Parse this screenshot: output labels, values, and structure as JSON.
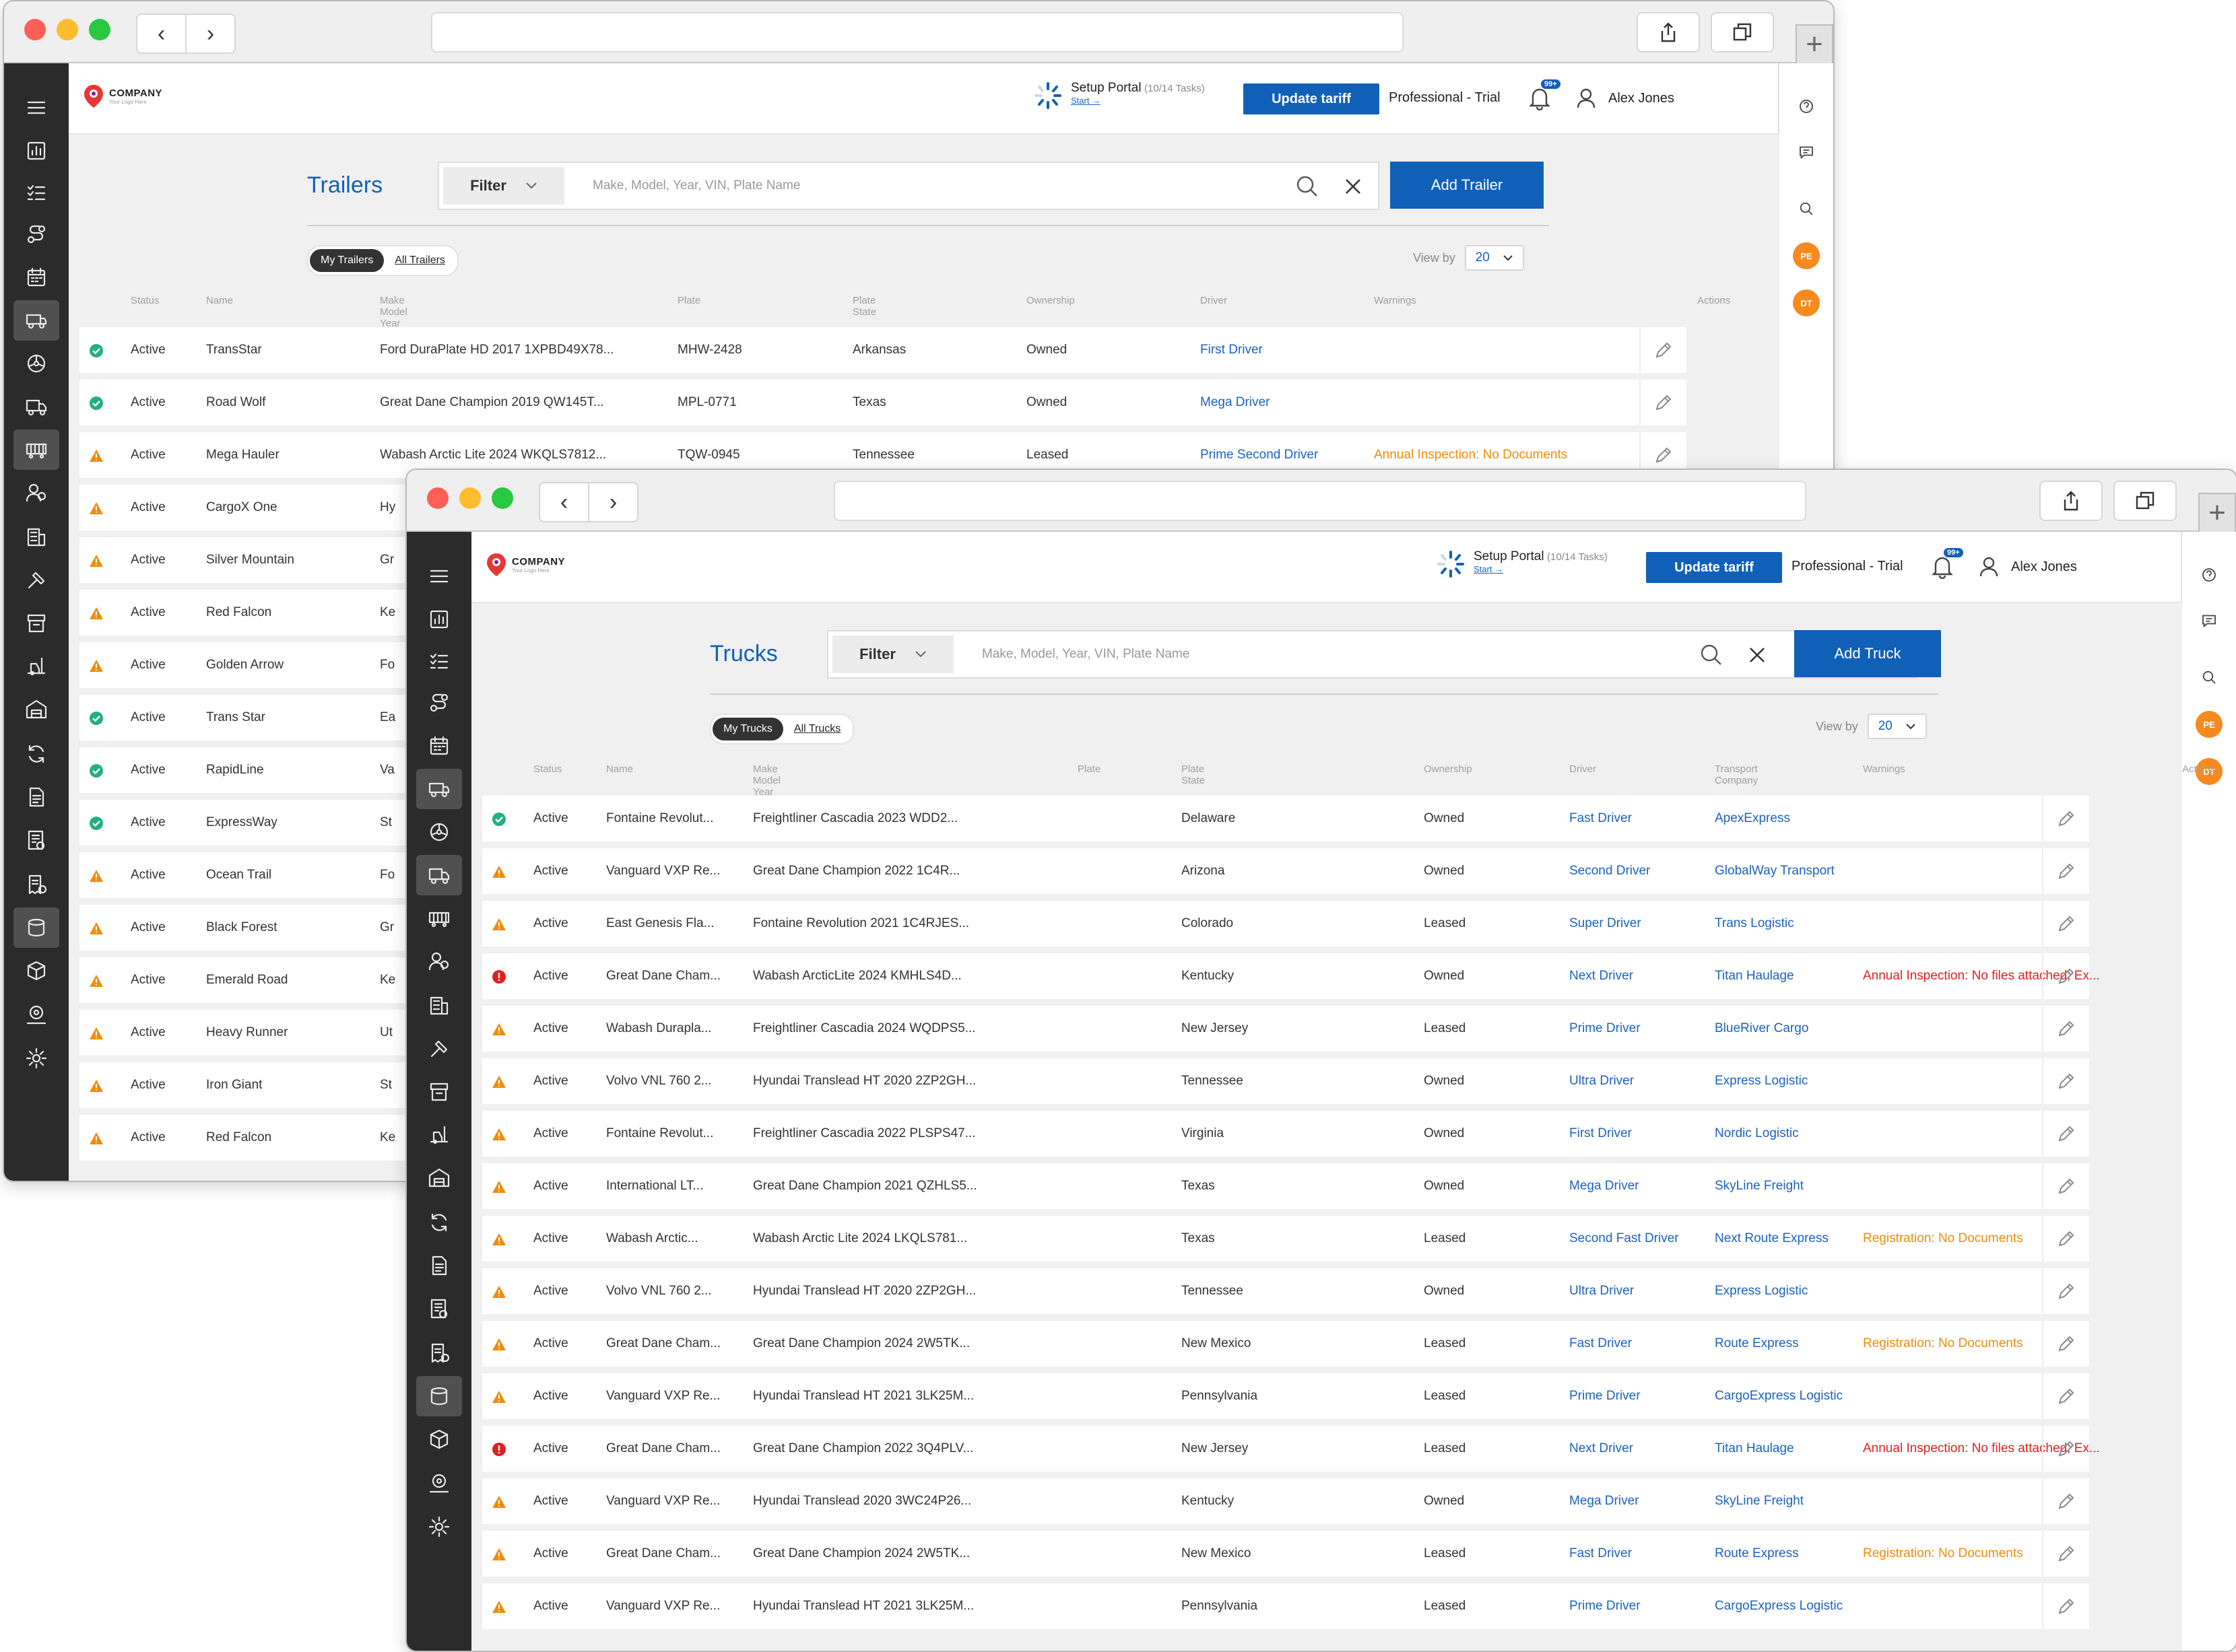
{
  "colors": {
    "accent": "#1160b8",
    "link": "#1a62c0",
    "ok": "#22b07d",
    "warn": "#f08c0a",
    "error": "#e02020",
    "sidebar": "#2b2b2b",
    "badge": "#f68a1e"
  },
  "common": {
    "logo_name": "COMPANY",
    "logo_tagline": "Your Logo Here",
    "setup_title": "Setup Portal",
    "setup_tasks": "(10/14 Tasks)",
    "setup_start": "Start →",
    "update_btn": "Update tariff",
    "plan": "Professional - Trial",
    "notif_badge": "99+",
    "user_name": "Alex Jones",
    "filter_label": "Filter",
    "search_placeholder": "Make, Model, Year, VIN, Plate Name",
    "view_by_label": "View by",
    "view_by_value": "20",
    "rightbar_badges": [
      "PE",
      "DT"
    ],
    "sidebar_icons": [
      "menu-icon",
      "dashboard-icon",
      "checklist-icon",
      "routes-icon",
      "calendar-icon",
      "trailer-icon",
      "wheel-icon",
      "truck-icon",
      "container-icon",
      "drivers-icon",
      "buildings-icon",
      "tools-icon",
      "archive-icon",
      "forklift-icon",
      "warehouse-icon",
      "sync-icon",
      "documents-icon",
      "reports-icon",
      "invoice-icon",
      "storage-icon",
      "package-icon",
      "location-icon",
      "settings-icon"
    ]
  },
  "trailers": {
    "title": "Trailers",
    "add_btn": "Add Trailer",
    "tab_mine": "My Trailers",
    "tab_all": "All Trailers",
    "columns": [
      "Status",
      "Name",
      "Make Model Year VIN",
      "Plate",
      "Plate State",
      "Ownership",
      "Driver",
      "Warnings",
      "Actions"
    ],
    "rows": [
      {
        "s": "ok",
        "status": "Active",
        "name": "TransStar",
        "vin": "Ford DuraPlate HD 2017 1XPBD49X78...",
        "plate": "MHW-2428",
        "state": "Arkansas",
        "own": "Owned",
        "driver": "First Driver",
        "warn": "",
        "wl": ""
      },
      {
        "s": "ok",
        "status": "Active",
        "name": "Road Wolf",
        "vin": "Great Dane Champion 2019 QW145T...",
        "plate": "MPL-0771",
        "state": "Texas",
        "own": "Owned",
        "driver": "Mega Driver",
        "warn": "",
        "wl": ""
      },
      {
        "s": "warn",
        "status": "Active",
        "name": "Mega Hauler",
        "vin": "Wabash Arctic Lite 2024 WKQLS7812...",
        "plate": "TQW-0945",
        "state": "Tennessee",
        "own": "Leased",
        "driver": "Prime Second Driver",
        "warn": "Annual Inspection: No Documents",
        "wl": "warn"
      },
      {
        "s": "warn",
        "status": "Active",
        "name": "CargoX One",
        "vin": "Hy",
        "plate": "",
        "state": "",
        "own": "",
        "driver": "",
        "warn": "",
        "wl": ""
      },
      {
        "s": "warn",
        "status": "Active",
        "name": "Silver Mountain",
        "vin": "Gr",
        "plate": "",
        "state": "",
        "own": "",
        "driver": "",
        "warn": "",
        "wl": ""
      },
      {
        "s": "warn",
        "status": "Active",
        "name": "Red Falcon",
        "vin": "Ke",
        "plate": "",
        "state": "",
        "own": "",
        "driver": "",
        "warn": "",
        "wl": ""
      },
      {
        "s": "warn",
        "status": "Active",
        "name": "Golden Arrow",
        "vin": "Fo",
        "plate": "",
        "state": "",
        "own": "",
        "driver": "",
        "warn": "",
        "wl": ""
      },
      {
        "s": "ok",
        "status": "Active",
        "name": "Trans Star",
        "vin": "Ea",
        "plate": "",
        "state": "",
        "own": "",
        "driver": "",
        "warn": "",
        "wl": ""
      },
      {
        "s": "ok",
        "status": "Active",
        "name": "RapidLine",
        "vin": "Va",
        "plate": "",
        "state": "",
        "own": "",
        "driver": "",
        "warn": "",
        "wl": ""
      },
      {
        "s": "ok",
        "status": "Active",
        "name": "ExpressWay",
        "vin": "St",
        "plate": "",
        "state": "",
        "own": "",
        "driver": "",
        "warn": "",
        "wl": ""
      },
      {
        "s": "warn",
        "status": "Active",
        "name": "Ocean Trail",
        "vin": "Fo",
        "plate": "",
        "state": "",
        "own": "",
        "driver": "",
        "warn": "",
        "wl": ""
      },
      {
        "s": "warn",
        "status": "Active",
        "name": "Black Forest",
        "vin": "Gr",
        "plate": "",
        "state": "",
        "own": "",
        "driver": "",
        "warn": "",
        "wl": ""
      },
      {
        "s": "warn",
        "status": "Active",
        "name": "Emerald Road",
        "vin": "Ke",
        "plate": "",
        "state": "",
        "own": "",
        "driver": "",
        "warn": "",
        "wl": ""
      },
      {
        "s": "warn",
        "status": "Active",
        "name": "Heavy Runner",
        "vin": "Ut",
        "plate": "",
        "state": "",
        "own": "",
        "driver": "",
        "warn": "",
        "wl": ""
      },
      {
        "s": "warn",
        "status": "Active",
        "name": "Iron Giant",
        "vin": "St",
        "plate": "",
        "state": "",
        "own": "",
        "driver": "",
        "warn": "",
        "wl": ""
      },
      {
        "s": "warn",
        "status": "Active",
        "name": "Red Falcon",
        "vin": "Ke",
        "plate": "",
        "state": "",
        "own": "",
        "driver": "",
        "warn": "",
        "wl": ""
      }
    ]
  },
  "trucks": {
    "title": "Trucks",
    "add_btn": "Add Truck",
    "tab_mine": "My Trucks",
    "tab_all": "All Trucks",
    "columns": [
      "Status",
      "Name",
      "Make Model Year VIN",
      "Plate",
      "Plate State",
      "Ownership",
      "Driver",
      "Transport Company",
      "Warnings",
      "Actions"
    ],
    "rows": [
      {
        "s": "ok",
        "status": "Active",
        "name": "Fontaine Revolut...",
        "vin": "Freightliner Cascadia 2023 WDD2...",
        "state": "Delaware",
        "own": "Owned",
        "driver": "Fast Driver",
        "company": "ApexExpress",
        "warn": "",
        "wl": ""
      },
      {
        "s": "warn",
        "status": "Active",
        "name": "Vanguard VXP Re...",
        "vin": "Great Dane Champion 2022 1C4R...",
        "state": "Arizona",
        "own": "Owned",
        "driver": "Second Driver",
        "company": "GlobalWay Transport",
        "warn": "",
        "wl": ""
      },
      {
        "s": "warn",
        "status": "Active",
        "name": "East Genesis Fla...",
        "vin": "Fontaine Revolution 2021 1C4RJES...",
        "state": "Colorado",
        "own": "Leased",
        "driver": "Super Driver",
        "company": "Trans Logistic",
        "warn": "",
        "wl": ""
      },
      {
        "s": "err",
        "status": "Active",
        "name": "Great Dane Cham...",
        "vin": "Wabash ArcticLite 2024 KMHLS4D...",
        "state": "Kentucky",
        "own": "Owned",
        "driver": "Next Driver",
        "company": "Titan Haulage",
        "warn": "Annual Inspection: No files attached; Ex...",
        "wl": "err"
      },
      {
        "s": "warn",
        "status": "Active",
        "name": "Wabash Durapla...",
        "vin": "Freightliner Cascadia 2024 WQDPS5...",
        "state": "New Jersey",
        "own": "Leased",
        "driver": "Prime Driver",
        "company": "BlueRiver Cargo",
        "warn": "",
        "wl": ""
      },
      {
        "s": "warn",
        "status": "Active",
        "name": "Volvo VNL 760 2...",
        "vin": "Hyundai Translead HT 2020 2ZP2GH...",
        "state": "Tennessee",
        "own": "Owned",
        "driver": "Ultra Driver",
        "company": "Express Logistic",
        "warn": "",
        "wl": ""
      },
      {
        "s": "warn",
        "status": "Active",
        "name": "Fontaine Revolut...",
        "vin": "Freightliner Cascadia 2022 PLSPS47...",
        "state": "Virginia",
        "own": "Owned",
        "driver": "First Driver",
        "company": "Nordic Logistic",
        "warn": "",
        "wl": ""
      },
      {
        "s": "warn",
        "status": "Active",
        "name": "International LT...",
        "vin": "Great Dane Champion 2021 QZHLS5...",
        "state": "Texas",
        "own": "Owned",
        "driver": "Mega Driver",
        "company": "SkyLine Freight",
        "warn": "",
        "wl": ""
      },
      {
        "s": "warn",
        "status": "Active",
        "name": "Wabash Arctic...",
        "vin": "Wabash Arctic Lite 2024 LKQLS781...",
        "state": "Texas",
        "own": "Leased",
        "driver": "Second Fast Driver",
        "company": "Next Route Express",
        "warn": "Registration: No Documents",
        "wl": "warn"
      },
      {
        "s": "warn",
        "status": "Active",
        "name": "Volvo VNL 760 2...",
        "vin": "Hyundai Translead HT 2020 2ZP2GH...",
        "state": "Tennessee",
        "own": "Owned",
        "driver": "Ultra Driver",
        "company": "Express Logistic",
        "warn": "",
        "wl": ""
      },
      {
        "s": "warn",
        "status": "Active",
        "name": "Great Dane Cham...",
        "vin": "Great Dane Champion 2024 2W5TK...",
        "state": "New Mexico",
        "own": "Leased",
        "driver": "Fast Driver",
        "company": "Route Express",
        "warn": "Registration: No Documents",
        "wl": "warn"
      },
      {
        "s": "warn",
        "status": "Active",
        "name": "Vanguard VXP Re...",
        "vin": "Hyundai Translead HT 2021 3LK25M...",
        "state": "Pennsylvania",
        "own": "Leased",
        "driver": "Prime Driver",
        "company": "CargoExpress Logistic",
        "warn": "",
        "wl": ""
      },
      {
        "s": "err",
        "status": "Active",
        "name": "Great Dane Cham...",
        "vin": "Great Dane Champion 2022 3Q4PLV...",
        "state": "New Jersey",
        "own": "Leased",
        "driver": "Next Driver",
        "company": "Titan Haulage",
        "warn": "Annual Inspection: No files attached; Ex...",
        "wl": "err"
      },
      {
        "s": "warn",
        "status": "Active",
        "name": "Vanguard VXP Re...",
        "vin": "Hyundai Translead  2020 3WC24P26...",
        "state": "Kentucky",
        "own": "Owned",
        "driver": "Mega Driver",
        "company": "SkyLine Freight",
        "warn": "",
        "wl": ""
      },
      {
        "s": "warn",
        "status": "Active",
        "name": "Great Dane Cham...",
        "vin": "Great Dane Champion 2024 2W5TK...",
        "state": "New Mexico",
        "own": "Leased",
        "driver": "Fast Driver",
        "company": "Route Express",
        "warn": "Registration: No Documents",
        "wl": "warn"
      },
      {
        "s": "warn",
        "status": "Active",
        "name": "Vanguard VXP Re...",
        "vin": "Hyundai Translead HT 2021 3LK25M...",
        "state": "Pennsylvania",
        "own": "Leased",
        "driver": "Prime Driver",
        "company": "CargoExpress Logistic",
        "warn": "",
        "wl": ""
      }
    ]
  }
}
